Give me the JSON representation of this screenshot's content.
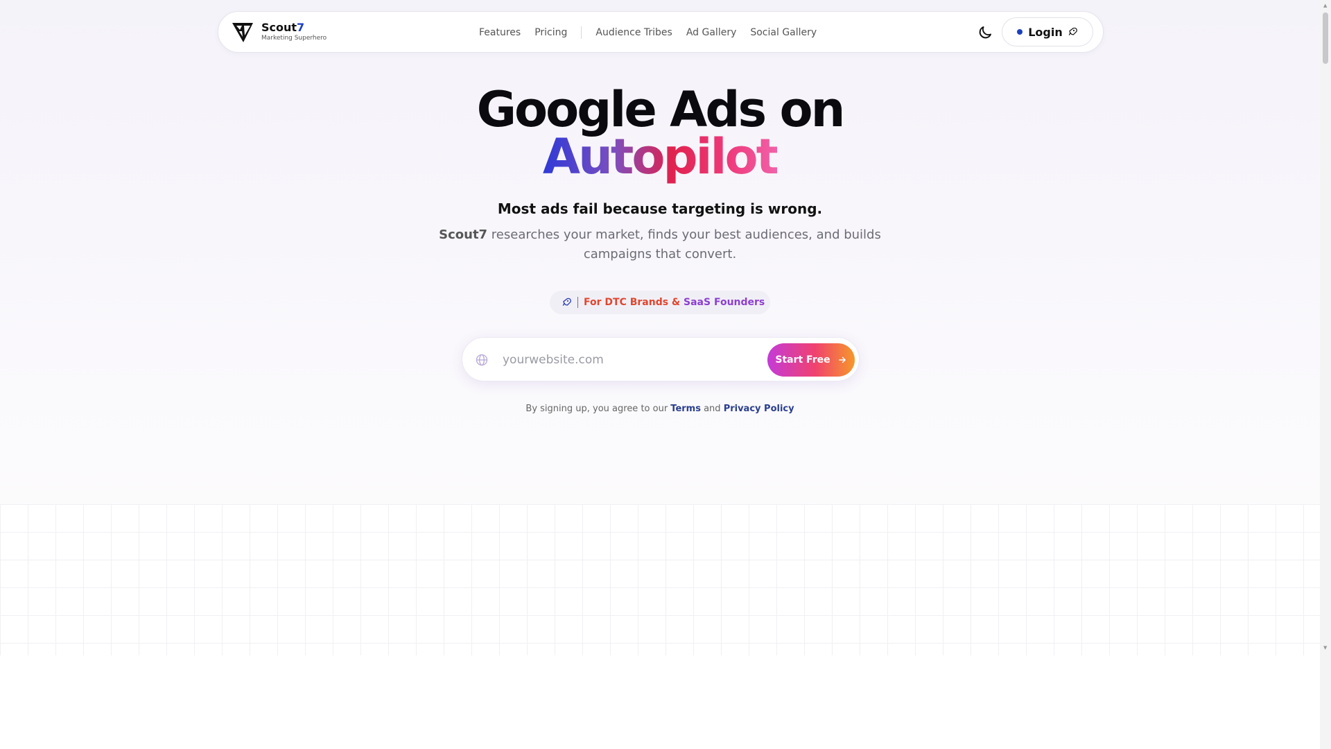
{
  "brand": {
    "name": "Scout",
    "name_suffix": "7",
    "tagline": "Marketing Superhero"
  },
  "nav": {
    "links": [
      "Features",
      "Pricing",
      "Audience Tribes",
      "Ad Gallery",
      "Social Gallery"
    ],
    "theme_toggle_icon": "moon-icon",
    "login_label": "Login"
  },
  "hero": {
    "line1": "Google Ads on",
    "line2": "Autopilot",
    "tagline": "Most ads fail because targeting is wrong.",
    "desc_brand": "Scout7",
    "desc_rest": " researches your market, finds your best audiences, and builds campaigns that convert."
  },
  "pill": {
    "part1": "For DTC Brands",
    "amp": " & ",
    "part2": "SaaS Founders"
  },
  "signup": {
    "placeholder": "yourwebsite.com",
    "button_label": "Start Free"
  },
  "legal": {
    "prefix": "By signing up, you agree to our ",
    "terms": "Terms",
    "and": " and ",
    "privacy": "Privacy Policy"
  },
  "colors": {
    "brand_blue": "#1d3fbf",
    "accent_orange": "#e0462e",
    "accent_purple": "#8c3fd1",
    "button_gradient_start": "#c43bd8",
    "button_gradient_end": "#f6982a"
  }
}
